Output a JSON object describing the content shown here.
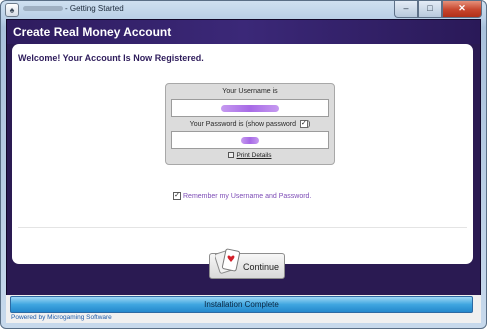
{
  "window": {
    "title_suffix": "- Getting Started",
    "controls": {
      "minimize": "–",
      "maximize": "□",
      "close": "✕"
    },
    "icon": "app-icon"
  },
  "header": {
    "title": "Create Real Money Account"
  },
  "panel": {
    "welcome": "Welcome! Your Account Is Now Registered.",
    "username_label": "Your Username is",
    "username_value": "ioce8034127782",
    "password_label": "Your Password is (show password",
    "password_label_close": ")",
    "password_value": "●●●●",
    "show_password_checked": "✓",
    "print_details": "Print Details",
    "remember_checked": "✓",
    "remember_label": "Remember my Username and Password.",
    "continue_label": "Continue"
  },
  "footer": {
    "progress_label": "Installation Complete",
    "progress": 1.0,
    "powered_by": "Powered by Microgaming Software"
  },
  "colors": {
    "header_bg": "#2e1c5e",
    "welcome_text": "#2f1d5c",
    "remember_text": "#7d4cb6",
    "progress_fill": "#3fa6e0"
  }
}
